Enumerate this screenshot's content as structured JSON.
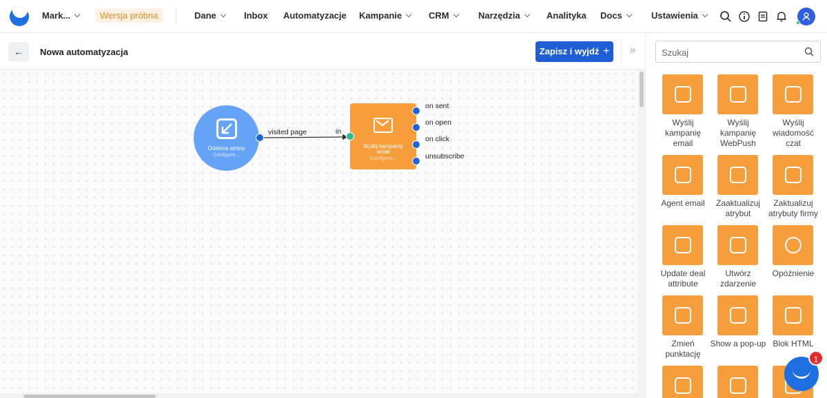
{
  "topbar": {
    "workspace": "Mark...",
    "trial_badge": "Wersja próbna",
    "nav": [
      {
        "label": "Dane",
        "dropdown": true
      },
      {
        "label": "Inbox",
        "dropdown": false
      },
      {
        "label": "Automatyzacje",
        "dropdown": false
      },
      {
        "label": "Kampanie",
        "dropdown": true
      },
      {
        "label": "CRM",
        "dropdown": true
      },
      {
        "label": "Narzędzia",
        "dropdown": true
      },
      {
        "label": "Analityka",
        "dropdown": false
      },
      {
        "label": "Docs",
        "dropdown": true
      },
      {
        "label": "Ustawienia",
        "dropdown": true
      }
    ],
    "icons": [
      "search-icon",
      "info-icon",
      "document-icon",
      "bell-icon",
      "user-avatar"
    ]
  },
  "editor": {
    "back_icon": "←",
    "title": "Nowa automatyzacja",
    "save_label": "Zapisz i wyjdź",
    "save_icon": "+",
    "collapse_icon": "»"
  },
  "flow": {
    "trigger": {
      "title": "Odsłona strony",
      "subtitle": "Configure..."
    },
    "connector_label": "visited page",
    "input_label": "in",
    "action": {
      "title": "Wyślij kampanię email",
      "subtitle": "Configure..."
    },
    "outputs": [
      "on sent",
      "on open",
      "on click",
      "unsubscribe"
    ]
  },
  "panel": {
    "search_placeholder": "Szukaj",
    "tiles": [
      {
        "label": "Wyślij kampanię email",
        "icon": "email-send-icon"
      },
      {
        "label": "Wyślij kampanię WebPush",
        "icon": "webpush-icon"
      },
      {
        "label": "Wyślij wiadomość czat",
        "icon": "chat-icon"
      },
      {
        "label": "Agent email",
        "icon": "agent-email-icon"
      },
      {
        "label": "Zaaktualizuj atrybut",
        "icon": "attribute-icon"
      },
      {
        "label": "Zaktualizuj atrybuty firmy",
        "icon": "company-attribute-icon"
      },
      {
        "label": "Update deal attribute",
        "icon": "deal-icon"
      },
      {
        "label": "Utwórz zdarzenie",
        "icon": "event-icon"
      },
      {
        "label": "Opóźnienie",
        "icon": "delay-icon"
      },
      {
        "label": "Zmień punktację",
        "icon": "scoring-icon"
      },
      {
        "label": "Show a pop-up",
        "icon": "popup-icon"
      },
      {
        "label": "Blok HTML",
        "icon": "html-icon"
      },
      {
        "label": "",
        "icon": "box-icon"
      },
      {
        "label": "",
        "icon": "checklist-icon"
      },
      {
        "label": "",
        "icon": "split-icon"
      }
    ]
  },
  "chat": {
    "badge": "1"
  }
}
